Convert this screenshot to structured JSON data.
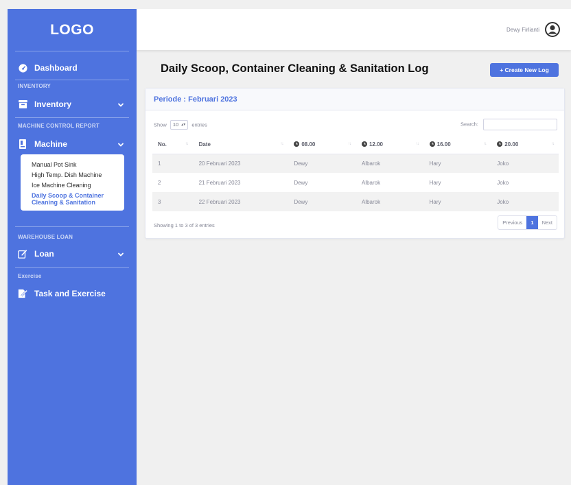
{
  "sidebar": {
    "logo": "LOGO",
    "dashboard": "Dashboard",
    "section_inventory": "INVENTORY",
    "inventory": "Inventory",
    "section_machine": "MACHINE CONTROL REPORT",
    "machine": "Machine",
    "machine_submenu": [
      "Manual Pot Sink",
      "High Temp. Dish Machine",
      "Ice Machine Cleaning"
    ],
    "machine_active_line1": "Daily Scoop & Container",
    "machine_active_line2": "Cleaning & Sanitation",
    "section_warehouse": "WAREHOUSE LOAN",
    "loan": "Loan",
    "section_exercise": "Exercise",
    "task": "Task and Exercise"
  },
  "topbar": {
    "username": "Dewy Firlianti"
  },
  "page": {
    "title": "Daily Scoop, Container Cleaning & Sanitation Log",
    "create_button": "+ Create New Log"
  },
  "card": {
    "period": "Periode : Februari 2023",
    "show_label": "Show",
    "show_value": "10",
    "entries_label": "entries",
    "search_label": "Search:",
    "columns": [
      "No.",
      "Date",
      "08.00",
      "12.00",
      "16.00",
      "20.00"
    ],
    "rows": [
      [
        "1",
        "20 Februari 2023",
        "Dewy",
        "Albarok",
        "Hary",
        "Joko"
      ],
      [
        "2",
        "21 Februari 2023",
        "Dewy",
        "Albarok",
        "Hary",
        "Joko"
      ],
      [
        "3",
        "22 Februari 2023",
        "Dewy",
        "Albarok",
        "Hary",
        "Joko"
      ]
    ],
    "showing": "Showing 1 to 3 of 3 entries",
    "pager": {
      "previous": "Previous",
      "page": "1",
      "next": "Next"
    }
  },
  "colors": {
    "primary": "#4e73df",
    "background": "#f0f0f0"
  },
  "icons": [
    "dashboard-icon",
    "inventory-box-icon",
    "chevron-down-icon",
    "machine-icon",
    "loan-edit-icon",
    "task-icon",
    "user-avatar-icon",
    "clock-icon",
    "sort-icon",
    "select-caret-icon"
  ]
}
